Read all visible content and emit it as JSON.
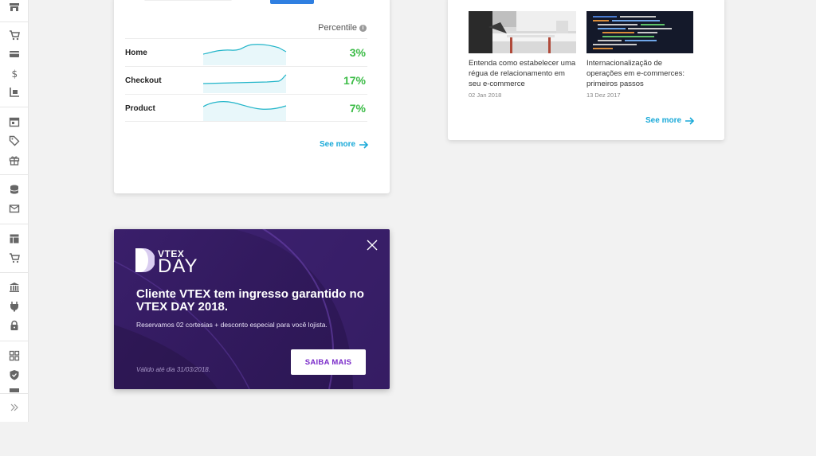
{
  "sidebar": {
    "icons": [
      "store-icon",
      "cart-icon",
      "credit-card-icon",
      "dollar-icon",
      "inventory-icon",
      "calendar-icon",
      "tag-icon",
      "gift-icon",
      "database-icon",
      "mail-icon",
      "layout-icon",
      "cart-settings-icon",
      "bank-icon",
      "plug-icon",
      "lock-icon",
      "apps-icon",
      "shield-icon",
      "folder-icon",
      "expand-icon"
    ]
  },
  "performance": {
    "column_header": "Percentile",
    "rows": [
      {
        "label": "Home",
        "value": "3%"
      },
      {
        "label": "Checkout",
        "value": "17%"
      },
      {
        "label": "Product",
        "value": "7%"
      }
    ],
    "see_more": "See more",
    "spark_color": "#22b5c9",
    "value_color": "#3dbc48"
  },
  "articles": {
    "items": [
      {
        "title": "Entenda como estabelecer uma régua de relacionamento em seu e-commerce",
        "date": "02 Jan 2018"
      },
      {
        "title": "Internacionalização de operações em e-commerces: primeiros passos",
        "date": "13 Dez 2017"
      }
    ],
    "see_more": "See more"
  },
  "promo": {
    "logo_top": "VTEX",
    "logo_bottom": "DAY",
    "title": "Cliente VTEX tem ingresso garantido no VTEX DAY 2018.",
    "subtitle": "Reservamos 02 cortesias + desconto especial para você lojista.",
    "valid_until": "Válido até dia 31/03/2018.",
    "button": "SAIBA MAIS",
    "accent": "#7a2bc9",
    "background": "#321a5e"
  },
  "colors": {
    "link": "#19a9d8",
    "primary_button": "#2f7fe1"
  }
}
